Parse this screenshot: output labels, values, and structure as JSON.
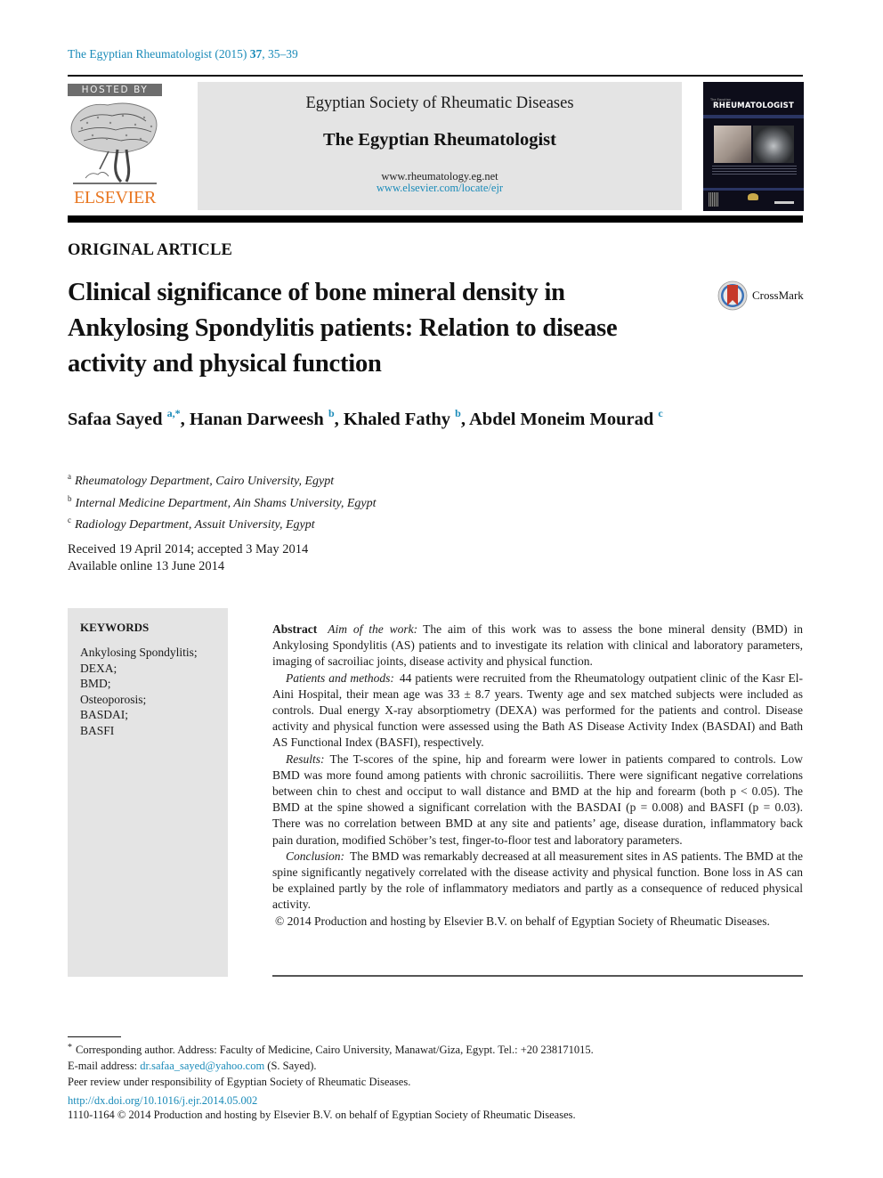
{
  "running_head": {
    "journal": "The Egyptian Rheumatologist (2015) ",
    "volume": "37",
    "pages": ", 35–39"
  },
  "publisher": {
    "hosted_by": "HOSTED BY",
    "name": "ELSEVIER"
  },
  "banner": {
    "society": "Egyptian Society of Rheumatic Diseases",
    "journal": "The Egyptian Rheumatologist",
    "url1": "www.rheumatology.eg.net",
    "url2": "www.elsevier.com/locate/ejr"
  },
  "cover": {
    "small_text": "The Egyptian",
    "title": "RHEUMATOLOGIST"
  },
  "article": {
    "type": "ORIGINAL ARTICLE",
    "title": "Clinical significance of bone mineral density in Ankylosing Spondylitis patients: Relation to disease activity and physical function",
    "crossmark": "CrossMark"
  },
  "authors": [
    {
      "name": "Safaa Sayed",
      "sup": "a,*",
      "sep": ", "
    },
    {
      "name": "Hanan Darweesh",
      "sup": "b",
      "sep": ", "
    },
    {
      "name": "Khaled Fathy",
      "sup": "b",
      "sep": ", "
    },
    {
      "name": "Abdel Moneim Mourad",
      "sup": "c",
      "sep": ""
    }
  ],
  "affiliations": [
    {
      "key": "a",
      "text": "Rheumatology Department, Cairo University, Egypt"
    },
    {
      "key": "b",
      "text": "Internal Medicine Department, Ain Shams University, Egypt"
    },
    {
      "key": "c",
      "text": "Radiology Department, Assuit University, Egypt"
    }
  ],
  "dates": {
    "received": "Received 19 April 2014; accepted 3 May 2014",
    "online": "Available online 13 June 2014"
  },
  "keywords": {
    "heading": "KEYWORDS",
    "items": [
      "Ankylosing Spondylitis;",
      "DEXA;",
      "BMD;",
      "Osteoporosis;",
      "BASDAI;",
      "BASFI"
    ]
  },
  "abstract": {
    "heading": "Abstract",
    "aim_label": "Aim of the work:",
    "aim_text": "The aim of this work was to assess the bone mineral density (BMD) in Ankylosing Spondylitis (AS) patients and to investigate its relation with clinical and laboratory parameters, imaging of sacroiliac joints, disease activity and physical function.",
    "methods_label": "Patients and methods:",
    "methods_text": "44 patients were recruited from the Rheumatology outpatient clinic of the Kasr El-Aini Hospital, their mean age was 33 ± 8.7 years. Twenty age and sex matched subjects were included as controls. Dual energy X-ray absorptiometry (DEXA) was performed for the patients and control. Disease activity and physical function were assessed using the Bath AS Disease Activity Index (BASDAI) and Bath AS Functional Index (BASFI), respectively.",
    "results_label": "Results:",
    "results_text": "The T-scores of the spine, hip and forearm were lower in patients compared to controls. Low BMD was more found among patients with chronic sacroiliitis. There were significant negative correlations between chin to chest and occiput to wall distance and BMD at the hip and forearm (both p < 0.05). The BMD at the spine showed a significant correlation with the BASDAI (p = 0.008) and BASFI (p = 0.03). There was no correlation between BMD at any site and patients’ age, disease duration, inflammatory back pain duration, modified Schöber’s test, finger-to-floor test and laboratory parameters.",
    "conclusion_label": "Conclusion:",
    "conclusion_text": "The BMD was remarkably decreased at all measurement sites in AS patients. The BMD at the spine significantly negatively correlated with the disease activity and physical function. Bone loss in AS can be explained partly by the role of inflammatory mediators and partly as a consequence of reduced physical activity.",
    "copyright": "© 2014 Production and hosting by Elsevier B.V. on behalf of Egyptian Society of Rheumatic Diseases."
  },
  "footnotes": {
    "star": "*",
    "corresponding": "Corresponding author. Address: Faculty of Medicine, Cairo University, Manawat/Giza, Egypt. Tel.: +20 238171015.",
    "email_label": "E-mail address: ",
    "email": "dr.safaa_sayed@yahoo.com",
    "email_suffix": " (S. Sayed).",
    "peer_review": "Peer review under responsibility of Egyptian Society of Rheumatic Diseases.",
    "doi": "http://dx.doi.org/10.1016/j.ejr.2014.05.002",
    "issn_line": "1110-1164 © 2014 Production and hosting by Elsevier B.V. on behalf of Egyptian Society of Rheumatic Diseases."
  },
  "colors": {
    "link": "#1a8bb9",
    "elsevier_orange": "#e87722",
    "banner_gray": "#e4e4e4"
  }
}
